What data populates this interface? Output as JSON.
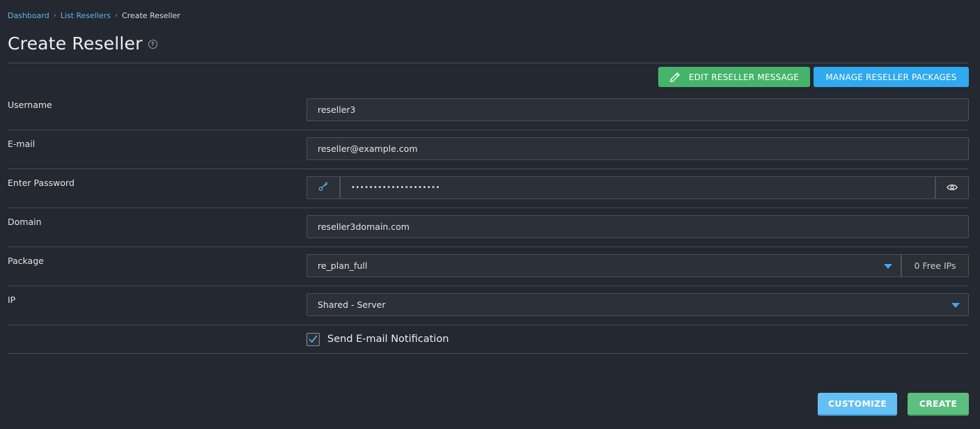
{
  "breadcrumb": {
    "items": [
      "Dashboard",
      "List Resellers"
    ],
    "current": "Create Reseller"
  },
  "page": {
    "title": "Create Reseller",
    "help_icon": "question-circle-icon"
  },
  "actions": {
    "edit_message_label": "EDIT RESELLER MESSAGE",
    "manage_packages_label": "MANAGE RESELLER PACKAGES"
  },
  "form": {
    "username": {
      "label": "Username",
      "value": "reseller3"
    },
    "email": {
      "label": "E-mail",
      "value": "reseller@example.com"
    },
    "password": {
      "label": "Enter Password",
      "value": "••••••••••••••••••••",
      "generate_icon": "key-generate-icon",
      "show_icon": "eye-icon"
    },
    "domain": {
      "label": "Domain",
      "value": "reseller3domain.com"
    },
    "package": {
      "label": "Package",
      "selected": "re_plan_full",
      "free_ips": "0 Free IPs"
    },
    "ip": {
      "label": "IP",
      "selected": "Shared - Server"
    },
    "notify": {
      "label": "Send E-mail Notification",
      "checked": true
    }
  },
  "footer": {
    "customize_label": "CUSTOMIZE",
    "create_label": "CREATE"
  },
  "colors": {
    "background": "#242830",
    "green": "#44b46b",
    "blue": "#2fa9ef",
    "link": "#5cb8f0"
  }
}
